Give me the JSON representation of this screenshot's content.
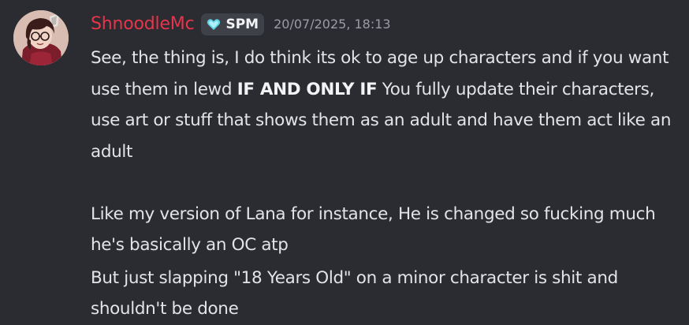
{
  "message": {
    "author": "ShnoodleMc",
    "tag": {
      "label": "SPM",
      "icon": "heart-icon",
      "icon_color": "#5fd4e8"
    },
    "timestamp": "20/07/2025, 18:13",
    "paragraphs": [
      {
        "before": "See, the thing is, I do think its ok to age up characters and if you want use them in lewd ",
        "bold": "IF AND ONLY IF",
        "after": " You fully update their characters, use art or stuff that shows them as an adult and have them act like an adult"
      },
      {
        "text": "Like my version of Lana for instance, He is changed so fucking much he's basically an OC atp"
      },
      {
        "text": "But just slapping \"18 Years Old\" on a minor character is shit and shouldn't be done"
      }
    ]
  },
  "colors": {
    "background": "#2b2c31",
    "username": "#e8344a",
    "text": "#e2e4e8",
    "timestamp": "#9a9ca5"
  }
}
